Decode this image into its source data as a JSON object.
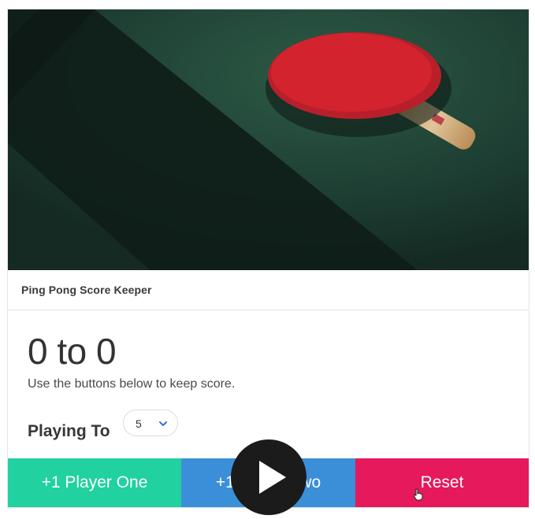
{
  "card": {
    "title": "Ping Pong Score Keeper"
  },
  "hero_image": {
    "icon": "ping-pong-paddle-photo"
  },
  "score": {
    "player_one": 0,
    "player_two": 0,
    "text": "0 to 0"
  },
  "instructions": "Use the buttons below to keep score.",
  "playing_to": {
    "label": "Playing To",
    "selected": "5"
  },
  "buttons": {
    "player_one": "+1 Player One",
    "player_two": "+1 Player Two",
    "reset": "Reset"
  },
  "colors": {
    "player_one": "#21d19f",
    "player_two": "#3b8fd8",
    "reset": "#e5195b",
    "chevron": "#3273dc"
  },
  "overlay": {
    "icon": "play-icon"
  }
}
